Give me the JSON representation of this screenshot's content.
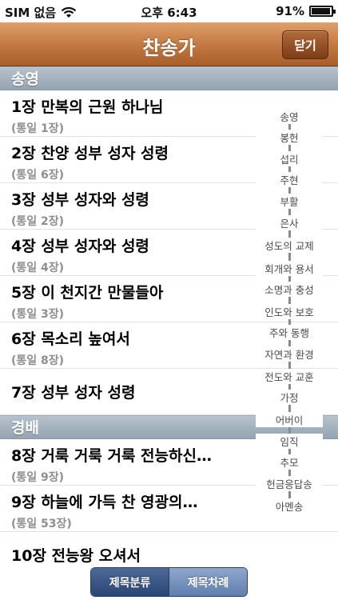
{
  "status": {
    "carrier": "SIM 없음",
    "time": "오후 6:43",
    "battery": "91%"
  },
  "nav": {
    "title": "찬송가",
    "close_label": "닫기"
  },
  "sections": [
    {
      "header": "송영",
      "rows": [
        {
          "title": "1장 만복의 근원 하나님",
          "sub": "(통일 1장)"
        },
        {
          "title": "2장 찬양 성부 성자 성령",
          "sub": "(통일 6장)"
        },
        {
          "title": "3장 성부 성자와 성령",
          "sub": "(통일 2장)"
        },
        {
          "title": "4장 성부 성자와 성령",
          "sub": "(통일 4장)"
        },
        {
          "title": "5장 이 천지간 만물들아",
          "sub": "(통일 3장)"
        },
        {
          "title": "6장 목소리 높여서",
          "sub": "(통일 8장)"
        },
        {
          "title": "7장 성부 성자 성령",
          "sub": ""
        }
      ]
    },
    {
      "header": "경배",
      "rows": [
        {
          "title": "8장 거룩 거룩 거룩 전능하신…",
          "sub": "(통일 9장)"
        },
        {
          "title": "9장 하늘에 가득 찬 영광의…",
          "sub": "(통일 53장)"
        },
        {
          "title": "10장 전능왕 오셔서",
          "sub": ""
        }
      ]
    }
  ],
  "index": [
    "송영",
    "봉헌",
    "섭리",
    "주현",
    "부활",
    "은사",
    "성도의 교제",
    "회개와 용서",
    "소명과 충성",
    "인도와 보호",
    "주와 동행",
    "자연과 환경",
    "전도와 교훈",
    "가정",
    "어버이",
    "임직",
    "추모",
    "헌금응답송",
    "아멘송"
  ],
  "segments": {
    "left": "제목분류",
    "right": "제목차례"
  }
}
